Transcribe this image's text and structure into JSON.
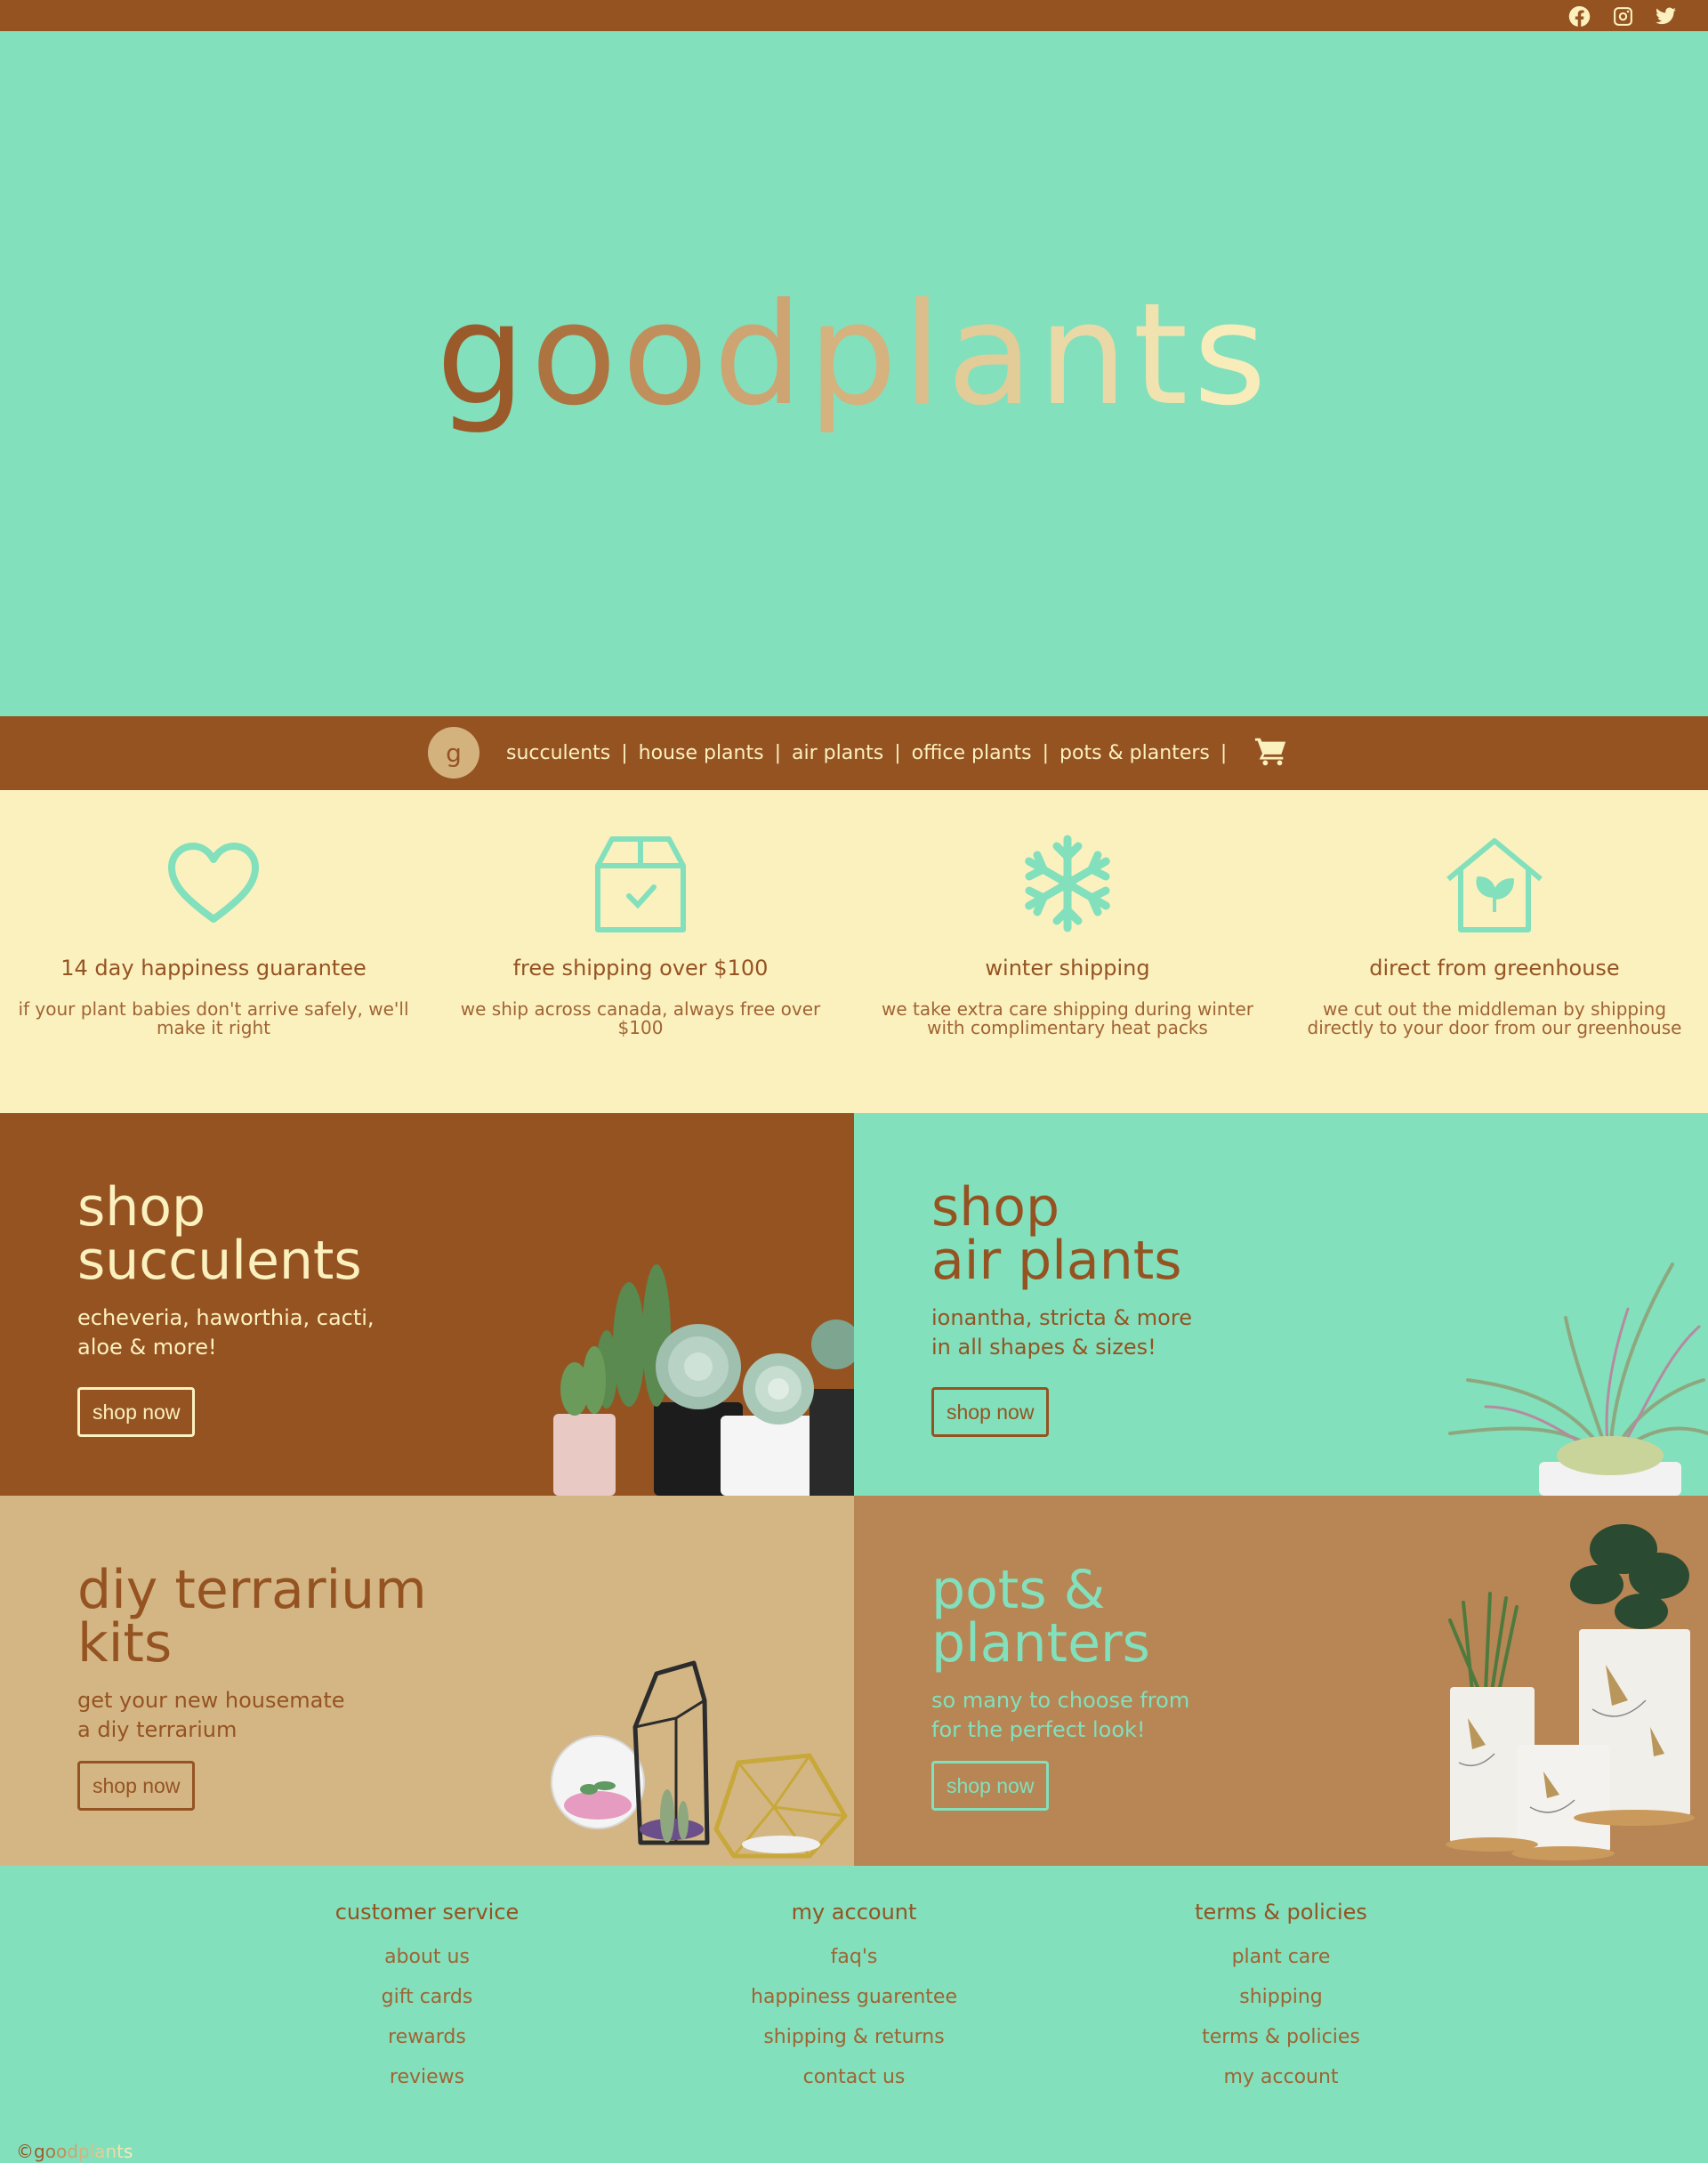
{
  "colors": {
    "brown": "#955322",
    "mint": "#82e0bc",
    "cream": "#fbf1bf",
    "tan": "#d4b27e",
    "caramel": "#b88555"
  },
  "topbar": {
    "social": [
      {
        "name": "facebook-icon"
      },
      {
        "name": "instagram-icon"
      },
      {
        "name": "twitter-icon"
      }
    ]
  },
  "hero": {
    "logo_letters": [
      "g",
      "o",
      "o",
      "d",
      "p",
      "l",
      "a",
      "n",
      "t",
      "s"
    ]
  },
  "nav": {
    "logo_letter": "g",
    "links": [
      "succulents",
      "house plants",
      "air plants",
      "office plants",
      "pots & planters"
    ],
    "separator": "|",
    "cart_icon": "cart-icon"
  },
  "features": [
    {
      "icon": "heart-icon",
      "title": "14 day happiness guarantee",
      "text": "if your plant babies don't arrive safely, we'll make it right"
    },
    {
      "icon": "box-icon",
      "title": "free shipping over $100",
      "text": "we ship across canada, always free over $100"
    },
    {
      "icon": "snowflake-icon",
      "title": "winter shipping",
      "text": "we take extra care shipping during winter with complimentary heat packs"
    },
    {
      "icon": "greenhouse-icon",
      "title": "direct from greenhouse",
      "text": "we cut out the middleman by shipping directly to your door from our greenhouse"
    }
  ],
  "tiles": {
    "succulents": {
      "title_1": "shop",
      "title_2": "succulents",
      "sub_1": "echeveria, haworthia, cacti,",
      "sub_2": "aloe & more!",
      "button": "shop now"
    },
    "air_plants": {
      "title_1": "shop",
      "title_2": "air plants",
      "sub_1": "ionantha, stricta & more",
      "sub_2": "in all shapes & sizes!",
      "button": "shop now"
    },
    "terrarium": {
      "title_1": "diy terrarium",
      "title_2": "kits",
      "sub_1": "get your new housemate",
      "sub_2": "a diy terrarium",
      "button": "shop now"
    },
    "pots": {
      "title_1": "pots &",
      "title_2": "planters",
      "sub_1": "so many to choose from",
      "sub_2": "for the perfect look!",
      "button": "shop now"
    }
  },
  "footer": {
    "columns": [
      {
        "heading": "customer service",
        "links": [
          "about us",
          "gift cards",
          "rewards",
          "reviews"
        ]
      },
      {
        "heading": "my account",
        "links": [
          "faq's",
          "happiness guarentee",
          "shipping & returns",
          "contact us"
        ]
      },
      {
        "heading": "terms & policies",
        "links": [
          "plant care",
          "shipping",
          "terms & policies",
          "my account"
        ]
      }
    ],
    "copyright_symbol": "©",
    "copyright_letters": [
      "g",
      "o",
      "o",
      "d",
      "p",
      "l",
      "a",
      "n",
      "t",
      "s"
    ]
  }
}
